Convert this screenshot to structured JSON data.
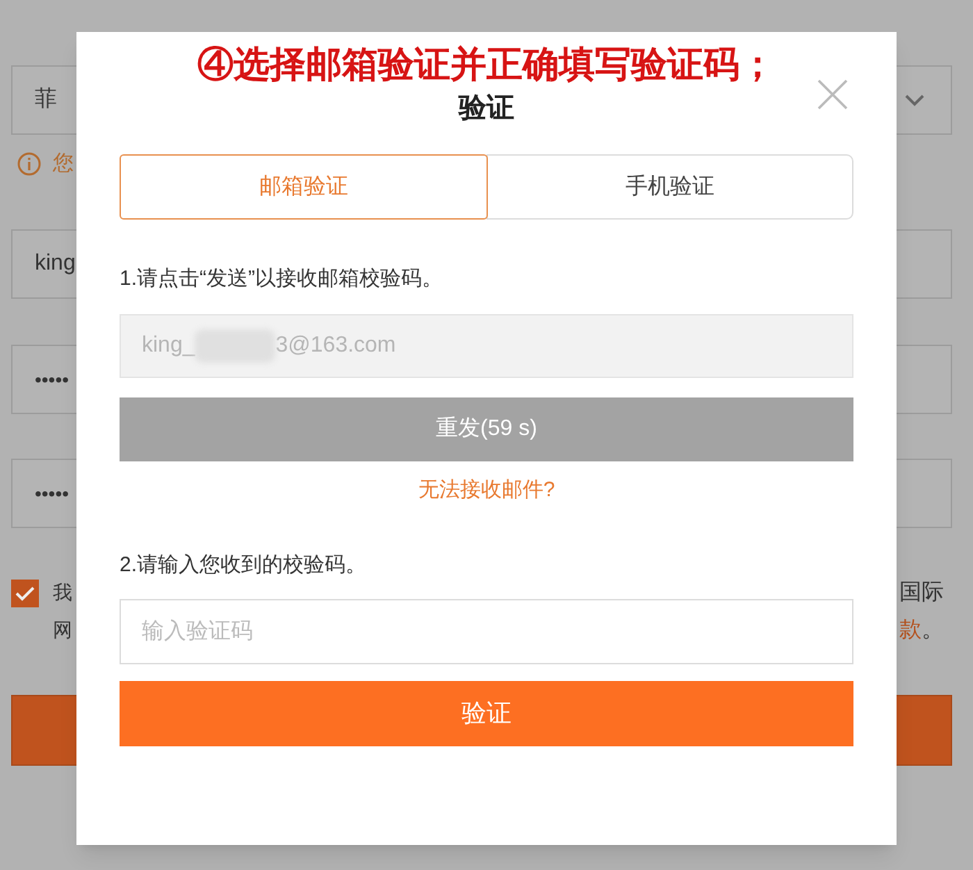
{
  "background_form": {
    "region_select": {
      "value": "菲"
    },
    "notice": {
      "text": "您"
    },
    "username": {
      "value": "king"
    },
    "password": {
      "value": "•••••"
    },
    "confirm_password": {
      "value": "•••••"
    },
    "agreement": {
      "checked": true,
      "line_1_start": "我",
      "line_1_end": "国际",
      "line_2_start": "网",
      "line_2_end_link": "款",
      "line_2_end": "。"
    }
  },
  "annotation": "④选择邮箱验证并正确填写验证码；",
  "dialog": {
    "title": "验证",
    "tabs": [
      {
        "label": "邮箱验证",
        "selected": true
      },
      {
        "label": "手机验证",
        "selected": false
      }
    ],
    "step_1": "1.请点击“发送”以接收邮箱校验码。",
    "email": {
      "value_start": "king_",
      "value_end": "3@163.com"
    },
    "resend_button": {
      "label": "重发(59 s)",
      "disabled": true
    },
    "help_link": "无法接收邮件?",
    "step_2": "2.请输入您收到的校验码。",
    "code_field": {
      "placeholder": "输入验证码"
    },
    "verify_button": "验证"
  }
}
